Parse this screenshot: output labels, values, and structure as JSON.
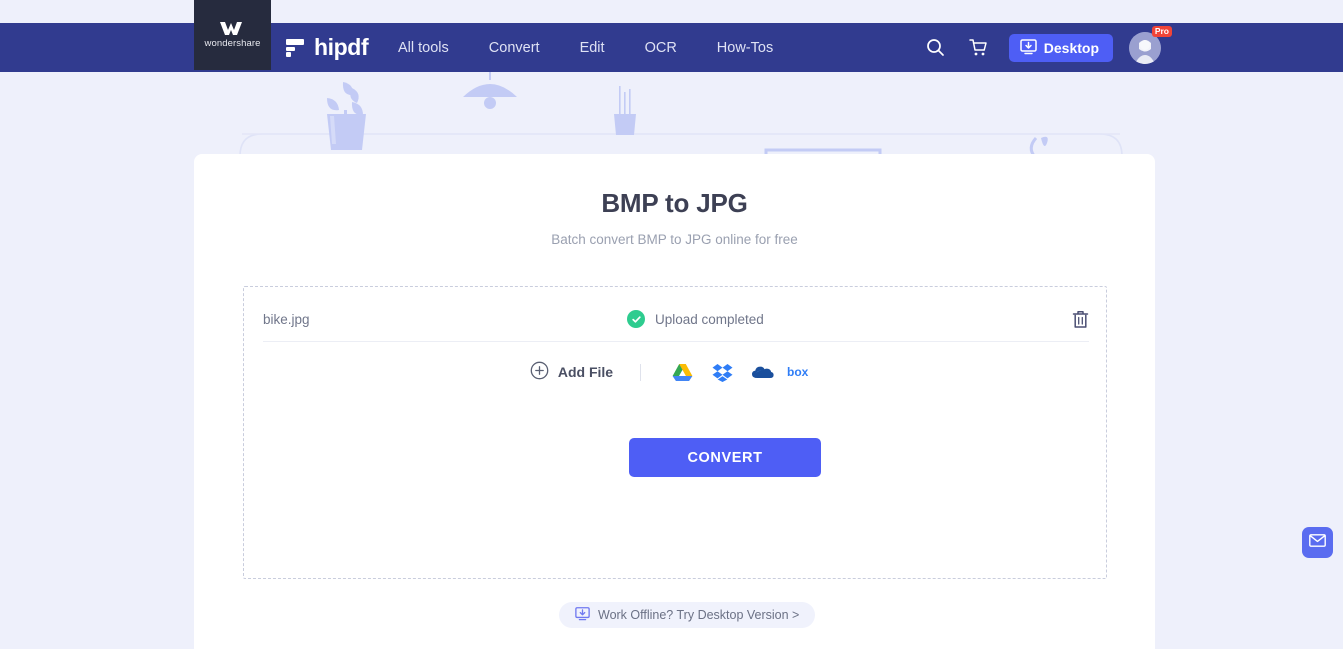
{
  "brand": {
    "wondershare_label": "wondershare",
    "wondershare_icon": "wondershare-w-mark",
    "logo_text": "hipdf",
    "logo_icon": "hipdf-logo-mark",
    "header_bg": "#313b8f",
    "wondershare_bg": "#262b3e"
  },
  "nav": {
    "items": [
      {
        "label": "All tools"
      },
      {
        "label": "Convert"
      },
      {
        "label": "Edit"
      },
      {
        "label": "OCR"
      },
      {
        "label": "How-Tos"
      }
    ]
  },
  "header_actions": {
    "search_icon": "search-icon",
    "cart_icon": "shopping-cart-icon",
    "desktop_label": "Desktop",
    "desktop_icon": "monitor-download-icon",
    "desktop_bg": "#4e5ef5",
    "avatar_icon": "user-avatar",
    "pro_badge": "Pro",
    "pro_badge_color": "#f04438"
  },
  "main": {
    "title": "BMP to JPG",
    "subtitle": "Batch convert BMP to JPG online for free"
  },
  "file_list": {
    "files": [
      {
        "name": "bike.jpg",
        "status": "Upload completed",
        "status_icon": "check-circle-icon",
        "status_color": "#2ecc8f",
        "delete_icon": "trash-icon"
      }
    ]
  },
  "add_file": {
    "label": "Add File",
    "icon": "plus-circle-icon",
    "cloud_sources": [
      {
        "name": "google-drive-icon"
      },
      {
        "name": "dropbox-icon"
      },
      {
        "name": "onedrive-icon"
      },
      {
        "name": "box-icon",
        "label": "box"
      }
    ]
  },
  "actions": {
    "convert_label": "CONVERT",
    "convert_color": "#4e5ef5"
  },
  "footer": {
    "offline_label": "Work Offline? Try Desktop Version >",
    "offline_icon": "monitor-download-icon"
  },
  "floating": {
    "mail_icon": "envelope-icon",
    "mail_color": "#5a6cf0"
  }
}
